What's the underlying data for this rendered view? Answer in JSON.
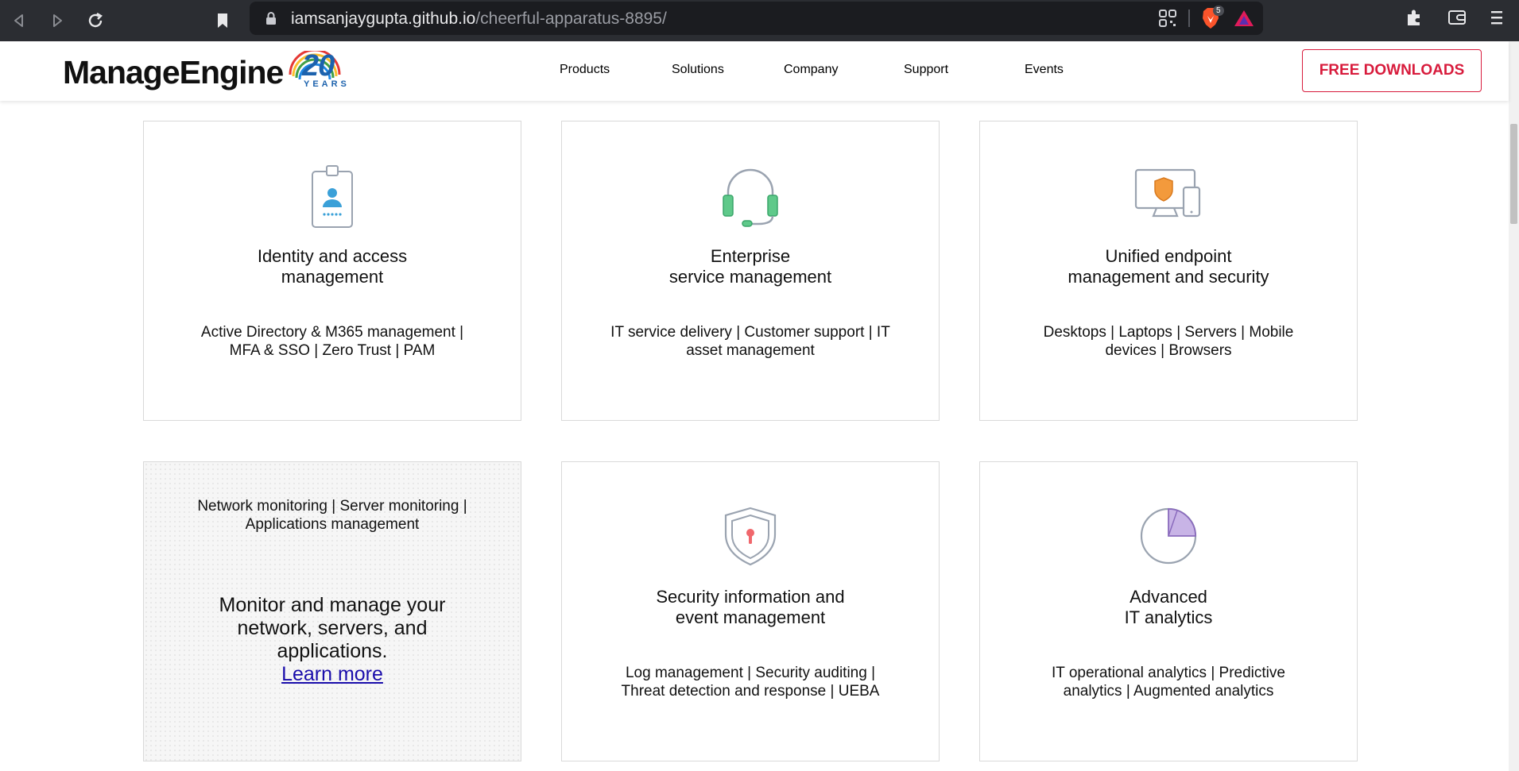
{
  "browser": {
    "url_host": "iamsanjaygupta.github.io",
    "url_path": "/cheerful-apparatus-8895/",
    "brave_badge": "5"
  },
  "header": {
    "logo_text": "ManageEngine",
    "anniversary_number": "20",
    "anniversary_label": "YEARS",
    "nav": [
      "Products",
      "Solutions",
      "Company",
      "Support",
      "Events"
    ],
    "cta": "FREE DOWNLOADS"
  },
  "cards": [
    {
      "icon": "id-badge-icon",
      "title_line1": "Identity and access",
      "title_line2": "management",
      "desc_line1": "Active Directory & M365 management |",
      "desc_line2": "MFA & SSO | Zero Trust | PAM"
    },
    {
      "icon": "headset-icon",
      "title_line1": "Enterprise",
      "title_line2": "service management",
      "desc_line1": "IT service delivery | Customer support | IT",
      "desc_line2": "asset management"
    },
    {
      "icon": "devices-shield-icon",
      "title_line1": "Unified endpoint",
      "title_line2": "management and security",
      "desc_line1": "Desktops | Laptops | Servers | Mobile",
      "desc_line2": "devices | Browsers"
    },
    {
      "icon": "network-icon",
      "desc_line1": "Network monitoring | Server monitoring |",
      "desc_line2": "Applications management",
      "hover_line1": "Monitor and manage your",
      "hover_line2": "network, servers, and",
      "hover_line3": "applications.",
      "link": "Learn more"
    },
    {
      "icon": "shield-keyhole-icon",
      "title_line1": "Security information and",
      "title_line2": "event management",
      "desc_line1": "Log management | Security auditing |",
      "desc_line2": "Threat detection and response | UEBA"
    },
    {
      "icon": "pie-chart-icon",
      "title_line1": "Advanced",
      "title_line2": "IT analytics",
      "desc_line1": "IT operational analytics | Predictive",
      "desc_line2": "analytics | Augmented analytics"
    }
  ],
  "colors": {
    "brand_red": "#d81b3c",
    "brand_blue": "#1c62ad",
    "chrome_dark": "#2b2d32",
    "link_blue": "#1a0dab"
  }
}
